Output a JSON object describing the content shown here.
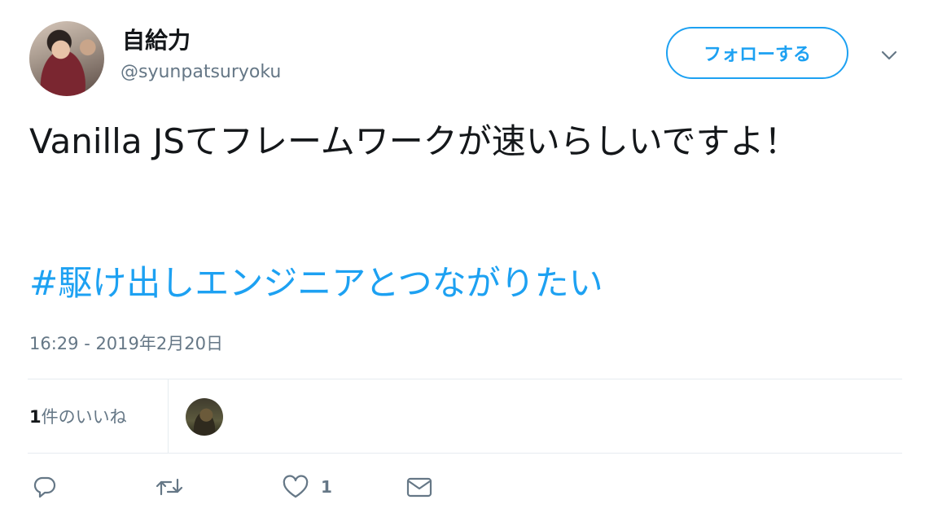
{
  "user": {
    "name": "自給力",
    "handle": "@syunpatsuryoku"
  },
  "follow_button": {
    "label": "フォローする"
  },
  "tweet": {
    "text": "Vanilla JSてフレームワークが速いらしいですよ！",
    "hashtag": "#駆け出しエンジニアとつながりたい",
    "timestamp": "16:29 - 2019年2月20日"
  },
  "likes": {
    "count": "1",
    "label_suffix": "件のいいね"
  },
  "actions": {
    "like_count": "1"
  },
  "icons": {
    "reply": "reply-icon",
    "retweet": "retweet-icon",
    "like": "heart-icon",
    "dm": "envelope-icon",
    "more": "chevron-down-icon"
  },
  "colors": {
    "accent": "#1da1f2",
    "text": "#14171a",
    "secondary": "#657786",
    "divider": "#e6ecf0"
  }
}
